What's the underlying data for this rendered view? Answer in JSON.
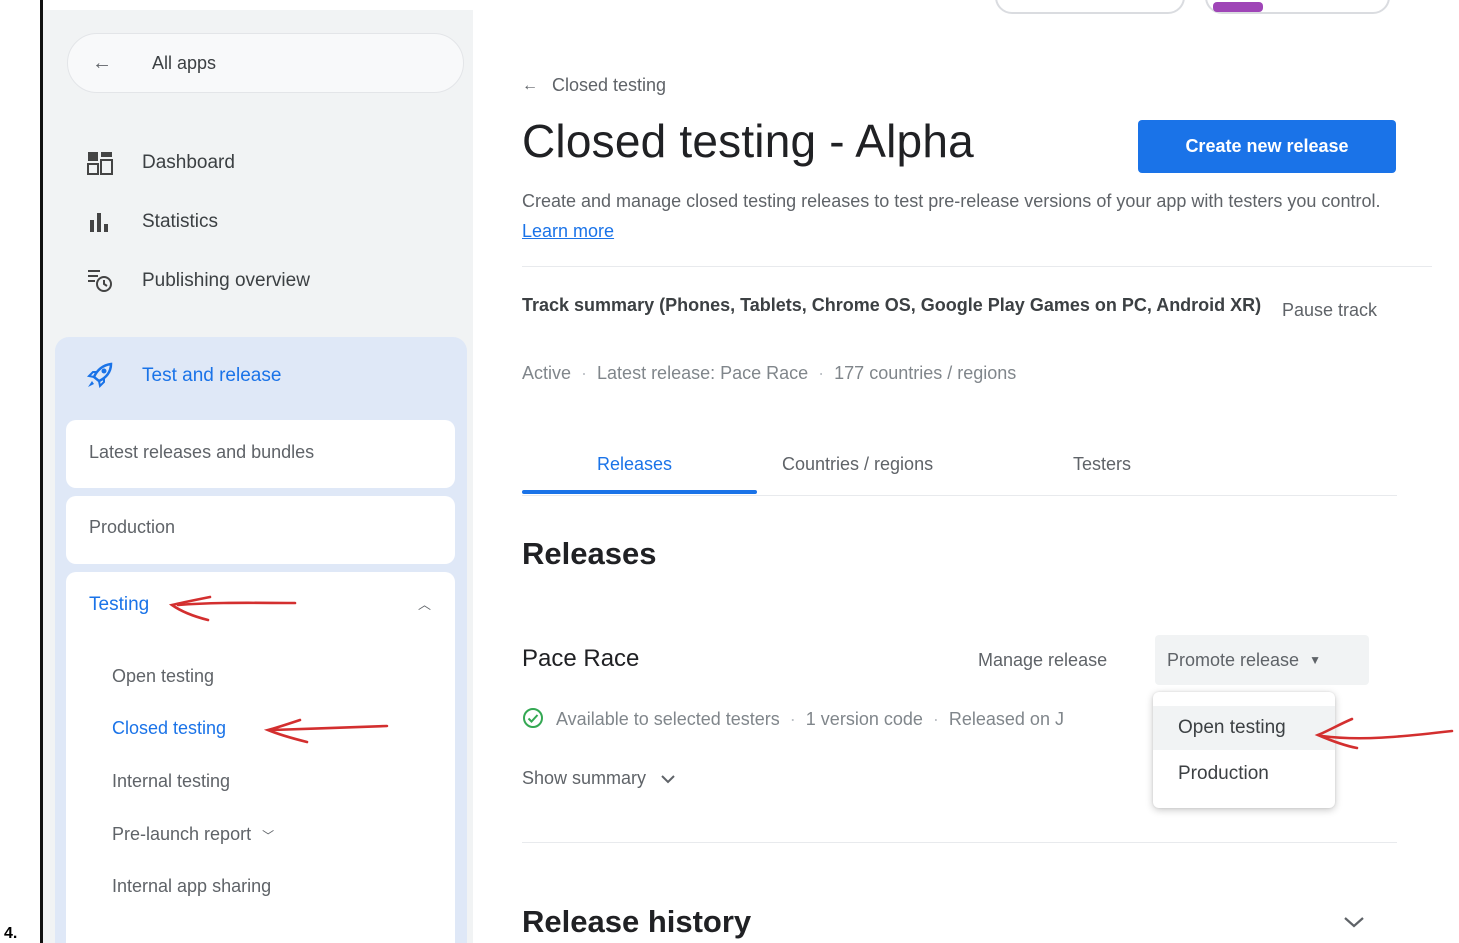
{
  "step_label": "4.",
  "sidebar": {
    "back_label": "All apps",
    "nav": [
      {
        "label": "Dashboard",
        "icon": "dashboard-icon"
      },
      {
        "label": "Statistics",
        "icon": "bar-chart-icon"
      },
      {
        "label": "Publishing overview",
        "icon": "publishing-overview-icon"
      }
    ],
    "section_title": "Test and release",
    "section_icon": "rocket-icon",
    "latest_releases": "Latest releases and bundles",
    "production": "Production",
    "testing": {
      "label": "Testing",
      "items": [
        "Open testing",
        "Closed testing",
        "Internal testing",
        "Pre-launch report",
        "Internal app sharing"
      ]
    }
  },
  "main": {
    "breadcrumb": "Closed testing",
    "title": "Closed testing - Alpha",
    "create_button": "Create new release",
    "description": "Create and manage closed testing releases to test pre-release versions of your app with testers you control.",
    "learn_more": "Learn more",
    "track_summary": "Track summary (Phones, Tablets, Chrome OS, Google Play Games on PC, Android XR)",
    "pause_track": "Pause track",
    "status": {
      "state": "Active",
      "latest_release": "Latest release: Pace Race",
      "countries": "177 countries / regions"
    },
    "tabs": [
      "Releases",
      "Countries / regions",
      "Testers"
    ],
    "releases_heading": "Releases",
    "release": {
      "name": "Pace Race",
      "manage": "Manage release",
      "promote": "Promote release",
      "availability": "Available to selected testers",
      "version_codes": "1 version code",
      "released_on": "Released on J",
      "show_summary": "Show summary"
    },
    "promote_menu": [
      "Open testing",
      "Production"
    ],
    "history_heading": "Release history"
  },
  "colors": {
    "accent": "#1a73e8",
    "annotation": "#d32f2f",
    "section_bg": "#dfe8f7"
  }
}
